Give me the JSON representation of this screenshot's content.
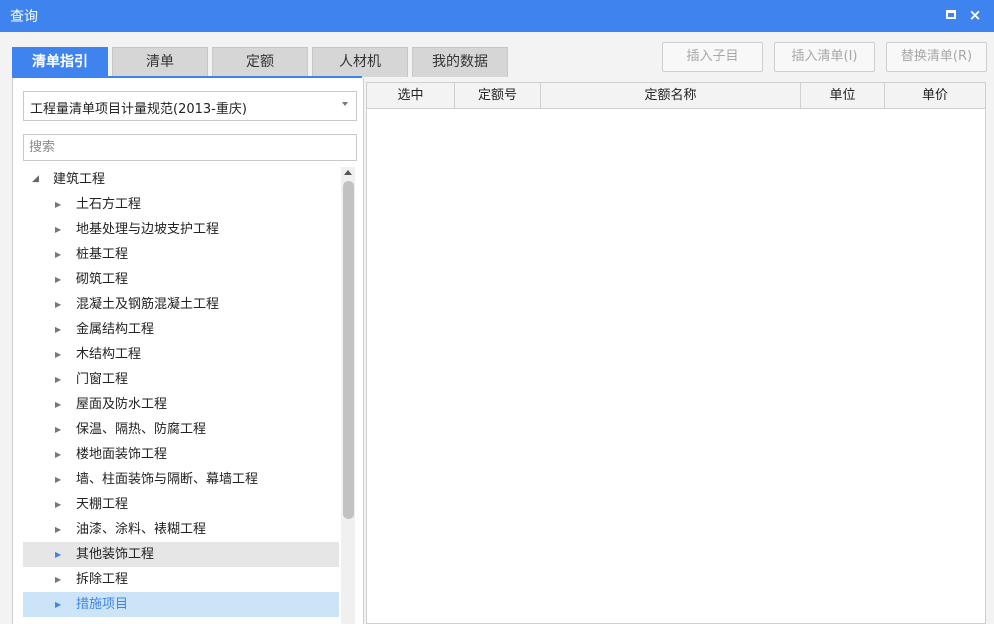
{
  "window": {
    "title": "查询",
    "maximize_label": "maximize",
    "close_label": "×"
  },
  "tabs": [
    {
      "label": "清单指引",
      "active": true
    },
    {
      "label": "清单",
      "active": false
    },
    {
      "label": "定额",
      "active": false
    },
    {
      "label": "人材机",
      "active": false
    },
    {
      "label": "我的数据",
      "active": false
    }
  ],
  "toolbar": {
    "insert_child": "插入子目",
    "insert_list": "插入清单(I)",
    "replace_list": "替换清单(R)"
  },
  "spec_select": {
    "value": "工程量清单项目计量规范(2013-重庆)"
  },
  "search": {
    "placeholder": "搜索"
  },
  "tree": {
    "root": "建筑工程",
    "children": [
      "土石方工程",
      "地基处理与边坡支护工程",
      "桩基工程",
      "砌筑工程",
      "混凝土及钢筋混凝土工程",
      "金属结构工程",
      "木结构工程",
      "门窗工程",
      "屋面及防水工程",
      "保温、隔热、防腐工程",
      "楼地面装饰工程",
      "墙、柱面装饰与隔断、幕墙工程",
      "天棚工程",
      "油漆、涂料、裱糊工程",
      "其他装饰工程",
      "拆除工程",
      "措施项目"
    ],
    "hover_item": "其他装饰工程",
    "selected_item": "措施项目"
  },
  "grid": {
    "columns": [
      "选中",
      "定额号",
      "定额名称",
      "单位",
      "单价"
    ]
  },
  "colors": {
    "accent": "#3f84ee",
    "selected_row": "#cce4f7",
    "hover_row": "#e6e6e6"
  }
}
